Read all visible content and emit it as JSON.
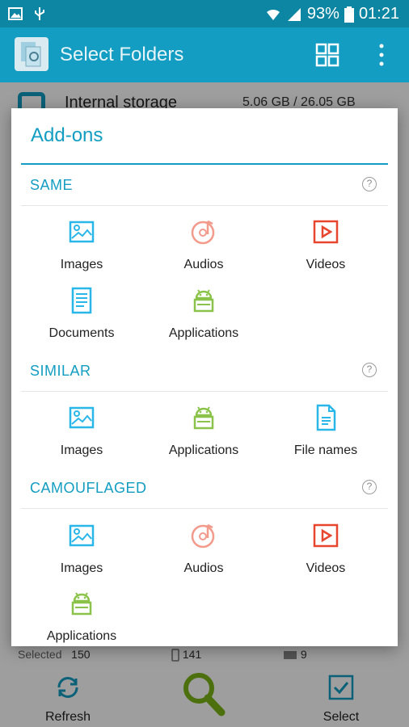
{
  "status_bar": {
    "battery": "93%",
    "time": "01:21"
  },
  "app_bar": {
    "title": "Select Folders"
  },
  "storage": {
    "label": "Internal storage",
    "size": "5.06 GB / 26.05 GB"
  },
  "bottom_bar": {
    "selected_label": "Selected",
    "selected_count": "150",
    "phone_count": "141",
    "sd_count": "9",
    "refresh_label": "Refresh",
    "select_label": "Select"
  },
  "dialog": {
    "title": "Add-ons",
    "sections": [
      {
        "label": "SAME",
        "items": [
          {
            "label": "Images",
            "icon": "image-icon"
          },
          {
            "label": "Audios",
            "icon": "audio-icon"
          },
          {
            "label": "Videos",
            "icon": "video-icon"
          },
          {
            "label": "Documents",
            "icon": "document-icon"
          },
          {
            "label": "Applications",
            "icon": "android-icon"
          }
        ]
      },
      {
        "label": "SIMILAR",
        "items": [
          {
            "label": "Images",
            "icon": "image-icon"
          },
          {
            "label": "Applications",
            "icon": "android-icon"
          },
          {
            "label": "File names",
            "icon": "file-icon"
          }
        ]
      },
      {
        "label": "CAMOUFLAGED",
        "items": [
          {
            "label": "Images",
            "icon": "image-icon"
          },
          {
            "label": "Audios",
            "icon": "audio-icon"
          },
          {
            "label": "Videos",
            "icon": "video-icon"
          },
          {
            "label": "Applications",
            "icon": "android-icon"
          }
        ]
      }
    ],
    "help_glyph": "?"
  },
  "colors": {
    "primary": "#139dc2",
    "status_bar": "#0c86a3",
    "image_icon": "#29b6e8",
    "audio_icon": "#f29b8c",
    "video_icon": "#e8452f",
    "android_icon": "#8bc34a"
  }
}
